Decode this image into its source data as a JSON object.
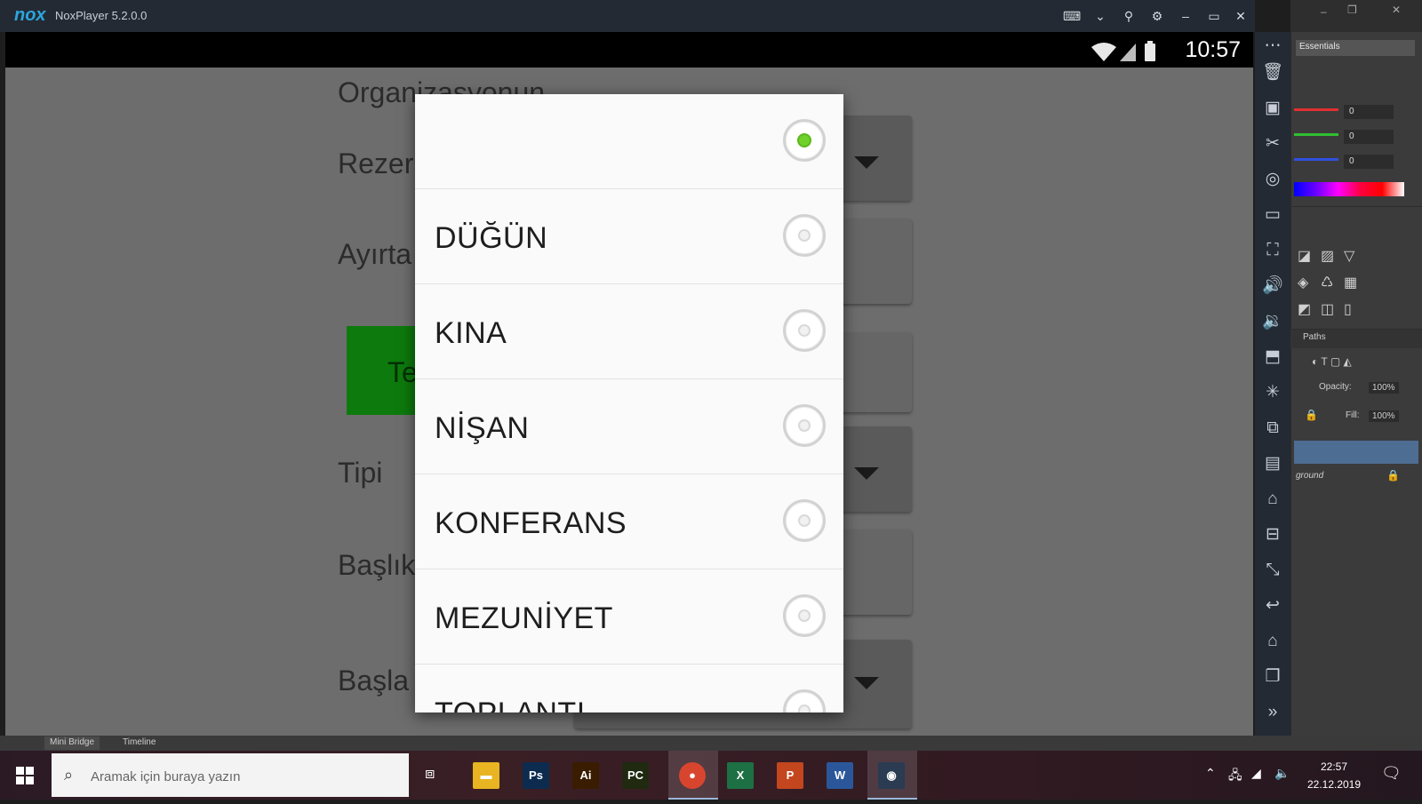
{
  "nox": {
    "title": "NoxPlayer 5.2.0.0",
    "logo_text": "nox"
  },
  "android": {
    "clock": "10:57",
    "background_labels": {
      "organizasyon": "Organizasyonun",
      "rezervasyon": "Rezer",
      "ayirt": "Ayırta",
      "button_fragment": "Te",
      "tipi": "Tipi",
      "baslik": "Başlık",
      "baslangic": "Başla"
    }
  },
  "dialog": {
    "options": [
      {
        "label": "",
        "selected": true
      },
      {
        "label": "DÜĞÜN",
        "selected": false
      },
      {
        "label": "KINA",
        "selected": false
      },
      {
        "label": "NİŞAN",
        "selected": false
      },
      {
        "label": "KONFERANS",
        "selected": false
      },
      {
        "label": "MEZUNİYET",
        "selected": false
      },
      {
        "label": "TOPLANTI",
        "selected": false
      }
    ],
    "selected_color": "#6fd12a"
  },
  "photoshop": {
    "workspace": "Essentials",
    "r_value": "0",
    "g_value": "0",
    "b_value": "0",
    "paths_label": "Paths",
    "opacity_label": "Opacity:",
    "opacity_value": "100%",
    "fill_label": "Fill:",
    "fill_value": "100%",
    "background_layer": "ground",
    "bottom_tabs": [
      "Mini Bridge",
      "Timeline"
    ]
  },
  "taskbar": {
    "search_placeholder": "Aramak için buraya yazın",
    "time": "22:57",
    "date": "22.12.2019",
    "apps": [
      {
        "name": "file-explorer",
        "glyph": "▬",
        "color": "#e8b422"
      },
      {
        "name": "photoshop",
        "glyph": "Ps",
        "color": "#0d2b4f"
      },
      {
        "name": "illustrator",
        "glyph": "Ai",
        "color": "#3a1d00"
      },
      {
        "name": "pycharm",
        "glyph": "PC",
        "color": "#1f2a10"
      },
      {
        "name": "chrome",
        "glyph": "●",
        "color": "#d8452f"
      },
      {
        "name": "excel",
        "glyph": "X",
        "color": "#1d7044"
      },
      {
        "name": "powerpoint",
        "glyph": "P",
        "color": "#c3461f"
      },
      {
        "name": "word",
        "glyph": "W",
        "color": "#2b579a"
      },
      {
        "name": "nox",
        "glyph": "◉",
        "color": "#2a3b52"
      }
    ]
  },
  "colors": {
    "dialog_bg": "#fafafa",
    "overlay": "#6d6d6d",
    "green_button": "#0d7a0d"
  }
}
